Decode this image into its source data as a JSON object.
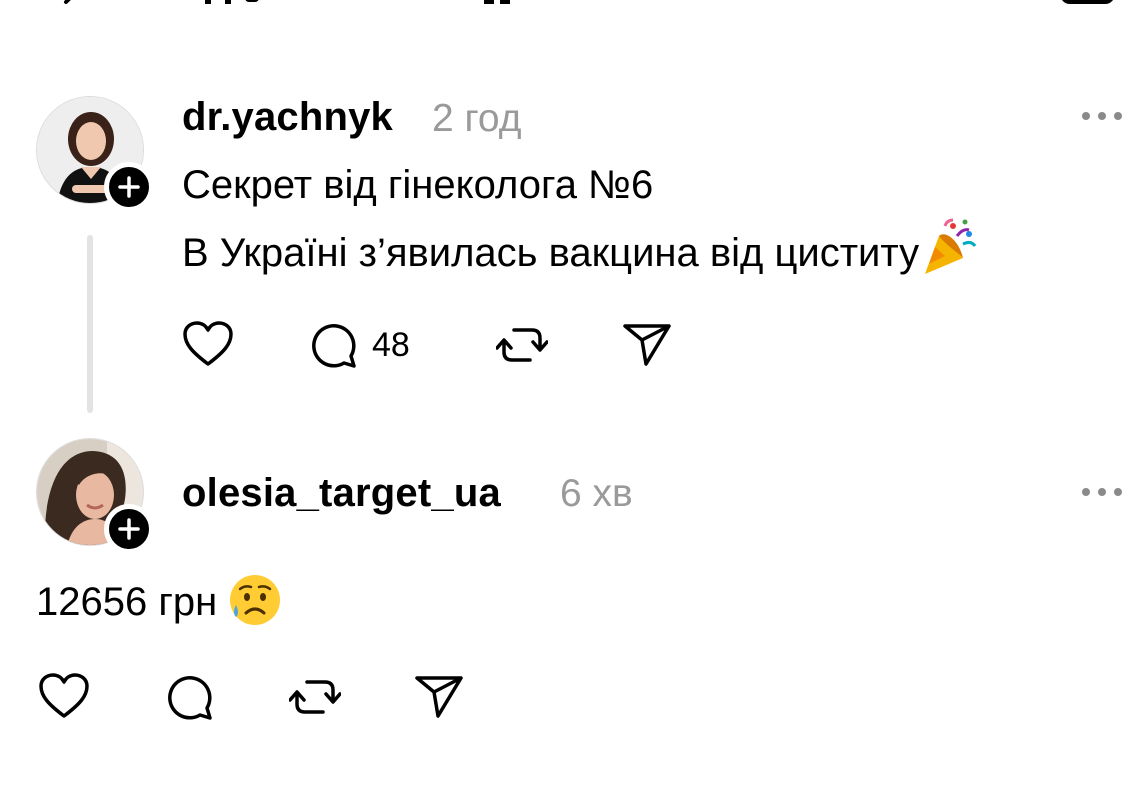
{
  "posts": [
    {
      "username": "dr.yachnyk",
      "timestamp": "2 год",
      "lines": [
        "Секрет від гінеколога №6",
        "В Україні з’явилась вакцина від циститу"
      ],
      "line_emoji": "party-popper",
      "comment_count": "48",
      "avatar": "avatar-photo"
    },
    {
      "username": "olesia_target_ua",
      "timestamp": "6 хв",
      "text": "12656 грн",
      "text_emoji": "sad-but-relieved-face",
      "avatar": "avatar-photo"
    }
  ],
  "icons": {
    "more": "more-options-icon",
    "like": "heart-icon",
    "comment": "comment-bubble-icon",
    "repost": "repost-icon",
    "share": "send-icon",
    "follow": "plus-icon"
  },
  "colors": {
    "text": "#000000",
    "muted": "#9a9a9a",
    "thread_line": "#e3e3e3",
    "badge": "#000000"
  }
}
